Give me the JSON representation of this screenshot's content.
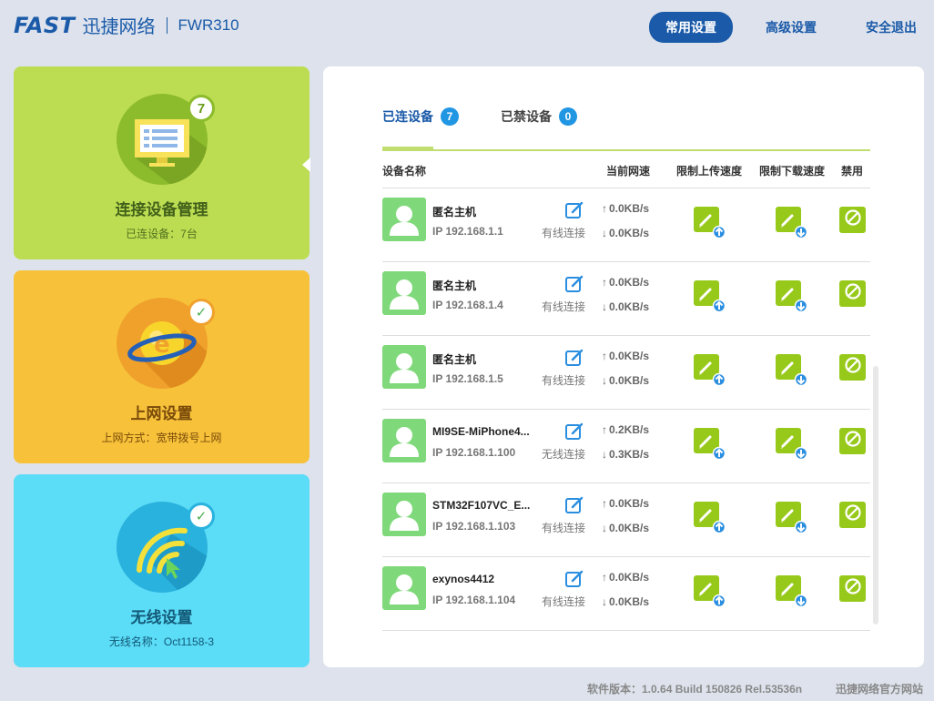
{
  "header": {
    "brand": "FAST",
    "brand_cn": "迅捷网络",
    "model": "FWR310",
    "nav": [
      {
        "label": "常用设置",
        "active": true
      },
      {
        "label": "高级设置",
        "active": false
      },
      {
        "label": "安全退出",
        "active": false
      }
    ]
  },
  "cards": [
    {
      "title": "连接设备管理",
      "subtitle": "已连设备：7台",
      "badge": "7",
      "icon": "monitor-icon"
    },
    {
      "title": "上网设置",
      "subtitle": "上网方式：宽带拨号上网",
      "badge": "✓",
      "icon": "internet-globe-icon"
    },
    {
      "title": "无线设置",
      "subtitle": "无线名称：Oct1158-3",
      "badge": "✓",
      "icon": "wifi-icon"
    }
  ],
  "tabs": [
    {
      "label": "已连设备",
      "count": "7",
      "active": true
    },
    {
      "label": "已禁设备",
      "count": "0",
      "active": false
    }
  ],
  "table": {
    "headers": {
      "name": "设备名称",
      "speed": "当前网速",
      "up_limit": "限制上传速度",
      "down_limit": "限制下载速度",
      "ban": "禁用"
    },
    "rows": [
      {
        "name": "匿名主机",
        "ip": "IP 192.168.1.1",
        "conn": "有线连接",
        "up": "0.0KB/s",
        "down": "0.0KB/s"
      },
      {
        "name": "匿名主机",
        "ip": "IP 192.168.1.4",
        "conn": "有线连接",
        "up": "0.0KB/s",
        "down": "0.0KB/s"
      },
      {
        "name": "匿名主机",
        "ip": "IP 192.168.1.5",
        "conn": "有线连接",
        "up": "0.0KB/s",
        "down": "0.0KB/s"
      },
      {
        "name": "MI9SE-MiPhone4...",
        "ip": "IP 192.168.1.100",
        "conn": "无线连接",
        "up": "0.2KB/s",
        "down": "0.3KB/s"
      },
      {
        "name": "STM32F107VC_E...",
        "ip": "IP 192.168.1.103",
        "conn": "有线连接",
        "up": "0.0KB/s",
        "down": "0.0KB/s"
      },
      {
        "name": "exynos4412",
        "ip": "IP 192.168.1.104",
        "conn": "有线连接",
        "up": "0.0KB/s",
        "down": "0.0KB/s"
      }
    ]
  },
  "footer": {
    "version": "软件版本：1.0.64 Build 150826 Rel.53536n",
    "site_link": "迅捷网络官方网站"
  },
  "colors": {
    "brand": "#1a5aa8",
    "card_green": "#bcdd52",
    "card_orange": "#f7c23a",
    "card_blue": "#5bdcf7",
    "accent_green": "#97c91a",
    "badge_blue": "#2196e3"
  }
}
